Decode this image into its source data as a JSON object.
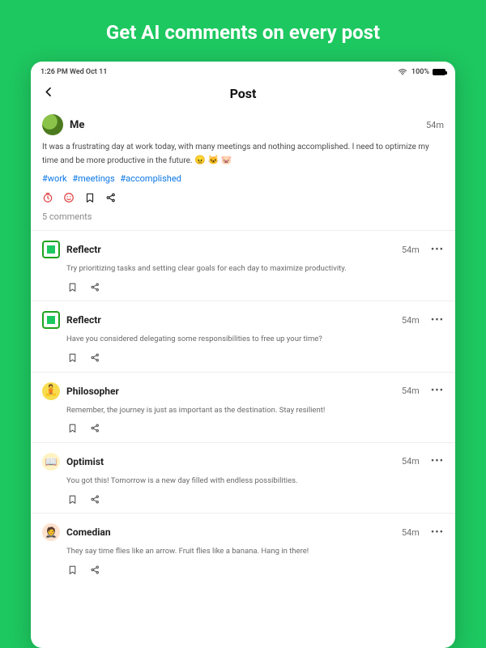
{
  "hero": "Get AI comments on every post",
  "statusbar": {
    "time": "1:26 PM  Wed Oct 11",
    "wifi": "wifi",
    "batteryPct": "100%"
  },
  "nav": {
    "title": "Post"
  },
  "post": {
    "author": "Me",
    "age": "54m",
    "body": "It was a frustrating day at work today, with many meetings and nothing accomplished. I need to optimize my time and be more productive in the future.",
    "emoji": "😠 🐱 🐷",
    "tags": [
      "#work",
      "#meetings",
      "#accomplished"
    ],
    "commentsCount": "5 comments"
  },
  "comments": [
    {
      "name": "Reflectr",
      "age": "54m",
      "body": "Try prioritizing tasks and setting clear goals for each day to maximize productivity.",
      "avatar": "reflectr"
    },
    {
      "name": "Reflectr",
      "age": "54m",
      "body": "Have you considered delegating some responsibilities to free up your time?",
      "avatar": "reflectr"
    },
    {
      "name": "Philosopher",
      "age": "54m",
      "body": "Remember, the journey is just as important as the destination. Stay resilient!",
      "avatar": "philo"
    },
    {
      "name": "Optimist",
      "age": "54m",
      "body": "You got this! Tomorrow is a new day filled with endless possibilities.",
      "avatar": "opt"
    },
    {
      "name": "Comedian",
      "age": "54m",
      "body": "They say time flies like an arrow. Fruit flies like a banana. Hang in there!",
      "avatar": "com"
    }
  ]
}
